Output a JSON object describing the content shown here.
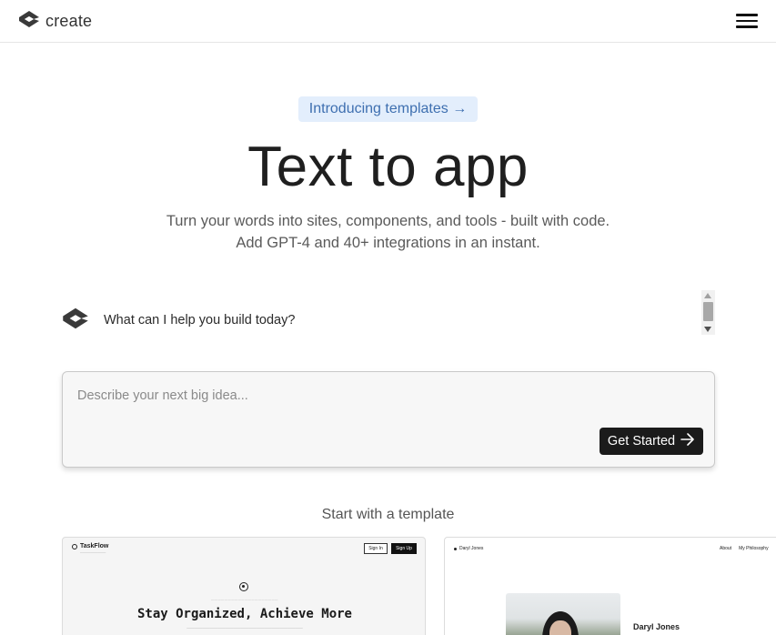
{
  "header": {
    "brand": "create",
    "logo_icon": "create-logo-icon",
    "menu_icon": "hamburger-menu-icon"
  },
  "hero": {
    "announcement": "Introducing templates →",
    "title": "Text to app",
    "subtitle_line1": "Turn your words into sites, components, and tools - built with code.",
    "subtitle_line2": "Add GPT-4 and 40+ integrations in an instant."
  },
  "assistant": {
    "avatar_icon": "create-logo-icon",
    "prompt": "What can I help you build today?"
  },
  "idea_box": {
    "placeholder": "Describe your next big idea...",
    "value": "",
    "submit_label": "Get Started",
    "submit_icon": "arrow-right-icon"
  },
  "templates": {
    "heading": "Start with a template",
    "cards": [
      {
        "app_name": "TaskFlow",
        "sign_in": "Sign In",
        "sign_up": "Sign Up",
        "headline": "Stay Organized, Achieve More"
      },
      {
        "site_name": "Daryl Jones",
        "nav": [
          "About",
          "My Philosophy"
        ],
        "person_name": "Daryl Jones"
      }
    ]
  },
  "colors": {
    "accent_pill_bg": "#e3eefc",
    "accent_pill_text": "#3e6fb0",
    "button_bg": "#1b1b1b"
  }
}
